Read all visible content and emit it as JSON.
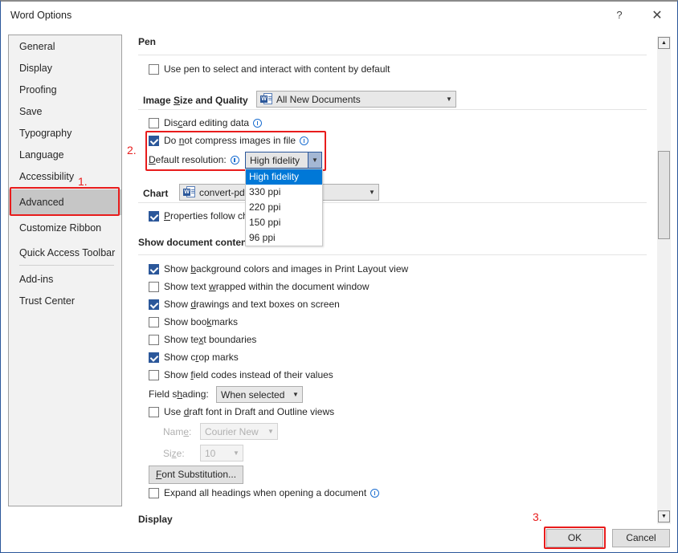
{
  "window": {
    "title": "Word Options",
    "help_label": "?",
    "close_label": "✕"
  },
  "sidebar": {
    "items": [
      {
        "label": "General"
      },
      {
        "label": "Display"
      },
      {
        "label": "Proofing"
      },
      {
        "label": "Save"
      },
      {
        "label": "Typography"
      },
      {
        "label": "Language"
      },
      {
        "label": "Accessibility"
      },
      {
        "label": "Advanced",
        "active": true
      },
      {
        "label": "Customize Ribbon"
      },
      {
        "label": "Quick Access Toolbar"
      },
      {
        "label": "Add-ins"
      },
      {
        "label": "Trust Center"
      }
    ]
  },
  "annotations": {
    "step1": "1.",
    "step2": "2.",
    "step3": "3.",
    "color": "#e81c1c"
  },
  "pen": {
    "title": "Pen",
    "use_pen": {
      "label": "Use pen to select and interact with content by default",
      "checked": false
    }
  },
  "image_quality": {
    "title_pre": "Image ",
    "title_u": "S",
    "title_post": "ize and Quality",
    "doc_select": "All New Documents",
    "discard": {
      "pre": "Dis",
      "u": "c",
      "post": "ard editing data",
      "checked": false
    },
    "no_compress": {
      "pre": "Do ",
      "u": "n",
      "post": "ot compress images in file",
      "checked": true
    },
    "resolution_label_u": "D",
    "resolution_label_post": "efault resolution:",
    "resolution_value": "High fidelity",
    "resolution_options": [
      "High fidelity",
      "330 ppi",
      "220 ppi",
      "150 ppi",
      "96 ppi"
    ],
    "resolution_selected": "High fidelity"
  },
  "chart": {
    "title": "Chart",
    "doc_select": "convert-pdf-to-word",
    "properties_follow": {
      "u": "P",
      "post": "roperties follow chart data point",
      "checked": true
    }
  },
  "show_doc": {
    "title": "Show document content",
    "options": [
      {
        "pre": "Show ",
        "u": "b",
        "post": "ackground colors and images in Print Layout view",
        "checked": true
      },
      {
        "pre": "Show text ",
        "u": "w",
        "post": "rapped within the document window",
        "checked": false
      },
      {
        "pre": "Show ",
        "u": "d",
        "post": "rawings and text boxes on screen",
        "checked": true
      },
      {
        "pre": "Show boo",
        "u": "k",
        "post": "marks",
        "checked": false
      },
      {
        "pre": "Show te",
        "u": "x",
        "post": "t boundaries",
        "checked": false
      },
      {
        "pre": "Show c",
        "u": "r",
        "post": "op marks",
        "checked": true
      },
      {
        "pre": "Show ",
        "u": "f",
        "post": "ield codes instead of their values",
        "checked": false
      }
    ],
    "field_shading_pre": "Field s",
    "field_shading_u": "h",
    "field_shading_post": "ading:",
    "field_shading_value": "When selected",
    "draft_font": {
      "pre": "Use ",
      "u": "d",
      "post": "raft font in Draft and Outline views",
      "checked": false
    },
    "name_label_pre": "Nam",
    "name_label_u": "e",
    "name_label_post": ":",
    "name_value": "Courier New",
    "size_label_pre": "Si",
    "size_label_u": "z",
    "size_label_post": "e:",
    "size_value": "10",
    "font_sub_u": "F",
    "font_sub_post": "ont Substitution...",
    "expand_headings": {
      "label": "Expand all headings when opening a document",
      "checked": false
    }
  },
  "display": {
    "title": "Display"
  },
  "footer": {
    "ok_label": "OK",
    "cancel_label": "Cancel"
  }
}
